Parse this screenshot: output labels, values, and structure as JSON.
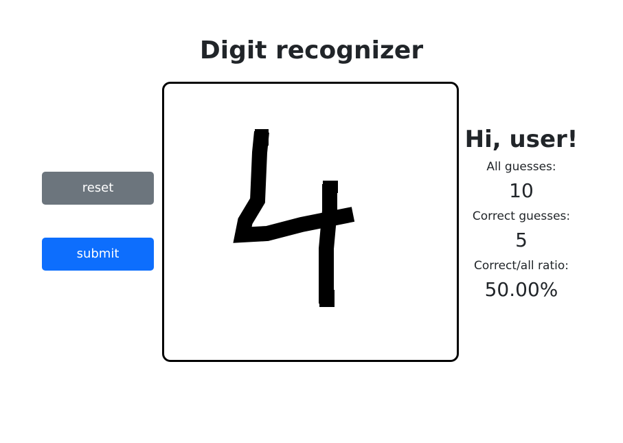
{
  "page": {
    "title": "Digit recognizer"
  },
  "controls": {
    "reset_label": "reset",
    "submit_label": "submit"
  },
  "stats": {
    "greeting": "Hi, user!",
    "all_guesses_label": "All guesses:",
    "all_guesses_value": "10",
    "correct_guesses_label": "Correct guesses:",
    "correct_guesses_value": "5",
    "ratio_label": "Correct/all ratio:",
    "ratio_value": "50.00%"
  },
  "colors": {
    "reset_button": "#6c757d",
    "submit_button": "#0d6efd",
    "canvas_border": "#000000",
    "ink": "#000000"
  }
}
